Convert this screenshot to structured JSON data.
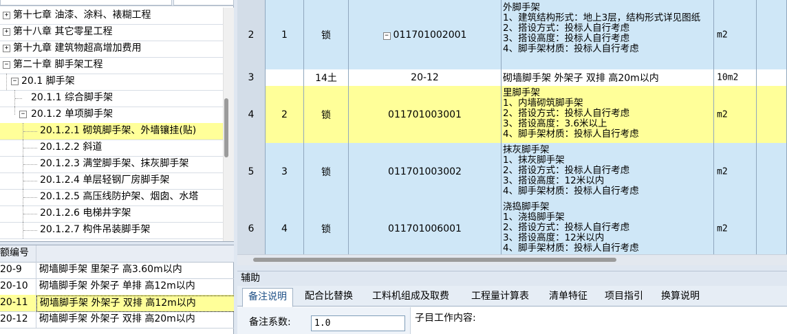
{
  "chapter_tree": [
    {
      "label": "第十七章  油漆、涂料、裱糊工程",
      "expander": "+"
    },
    {
      "label": "第十八章  其它零星工程",
      "expander": "+"
    },
    {
      "label": "第十九章  建筑物超高增加费用",
      "expander": "+"
    },
    {
      "label": "第二十章  脚手架工程",
      "expander": "−"
    },
    {
      "label": "20.1  脚手架",
      "expander": "−"
    },
    {
      "label": "20.1.1  综合脚手架",
      "expander": ""
    },
    {
      "label": "20.1.2  单项脚手架",
      "expander": "−"
    },
    {
      "label": "20.1.2.1  砌筑脚手架、外墙镶挂(贴)",
      "expander": ""
    },
    {
      "label": "20.1.2.2  斜道",
      "expander": ""
    },
    {
      "label": "20.1.2.3  满堂脚手架、抹灰脚手架",
      "expander": ""
    },
    {
      "label": "20.1.2.4  单层轻钢厂房脚手架",
      "expander": ""
    },
    {
      "label": "20.1.2.5  高压线防护架、烟囱、水塔",
      "expander": ""
    },
    {
      "label": "20.1.2.6  电梯井字架",
      "expander": ""
    },
    {
      "label": "20.1.2.7  构件吊装脚手架",
      "expander": ""
    }
  ],
  "quota_table": {
    "header": "额编号",
    "rows": [
      {
        "code": "20-9",
        "name": "砌墙脚手架 里架子 高3.60m以内"
      },
      {
        "code": "20-10",
        "name": "砌墙脚手架 外架子 单排 高12m以内"
      },
      {
        "code": "20-11",
        "name": "砌墙脚手架 外架子 双排 高12m以内"
      },
      {
        "code": "20-12",
        "name": "砌墙脚手架 外架子 双排 高20m以内"
      }
    ]
  },
  "main_grid": {
    "rows": [
      {
        "num": "2",
        "seq": "1",
        "kind": "锁",
        "code": "011701002001",
        "code_expander": "−",
        "desc": "外脚手架\n1、建筑结构形式：地上3层，结构形式详见图纸\n2、搭设方式：投标人自行考虑\n3、搭设高度：投标人自行考虑\n4、脚手架材质：投标人自行考虑",
        "unit": "m2"
      },
      {
        "num": "3",
        "seq": "",
        "kind": "14土",
        "code": "20-12",
        "code_expander": "",
        "desc": "砌墙脚手架 外架子 双排 高20m以内",
        "unit": "10m2"
      },
      {
        "num": "4",
        "seq": "2",
        "kind": "锁",
        "code": "011701003001",
        "code_expander": "",
        "desc": "里脚手架\n1、内墙砌筑脚手架\n2、搭设方式：投标人自行考虑\n3、搭设高度：3.6米以上\n4、脚手架材质：投标人自行考虑",
        "unit": "m2"
      },
      {
        "num": "5",
        "seq": "3",
        "kind": "锁",
        "code": "011701003002",
        "code_expander": "",
        "desc": "抹灰脚手架\n1、抹灰脚手架\n2、搭设方式：投标人自行考虑\n3、搭设高度：12米以内\n4、脚手架材质：投标人自行考虑",
        "unit": "m2"
      },
      {
        "num": "6",
        "seq": "4",
        "kind": "锁",
        "code": "011701006001",
        "code_expander": "",
        "desc": "浇捣脚手架\n1、浇捣脚手架\n2、搭设方式：投标人自行考虑\n3、搭设高度：12米以内\n4、脚手架材质：投标人自行考虑",
        "unit": "m2"
      }
    ]
  },
  "aux_panel": {
    "title": "辅助",
    "tabs": [
      "备注说明",
      "配合比替换",
      "工料机组成及取费",
      "工程量计算表",
      "清单特征",
      "项目指引",
      "换算说明"
    ],
    "active_tab": "备注说明",
    "factor_label": "备注系数:",
    "factor_value": "1.0",
    "work_label": "子目工作内容:"
  },
  "colors": {
    "selected_row": "#ffff99",
    "grid_row_blue": "#cfe7f7",
    "panel_background": "#dfe7f1"
  }
}
